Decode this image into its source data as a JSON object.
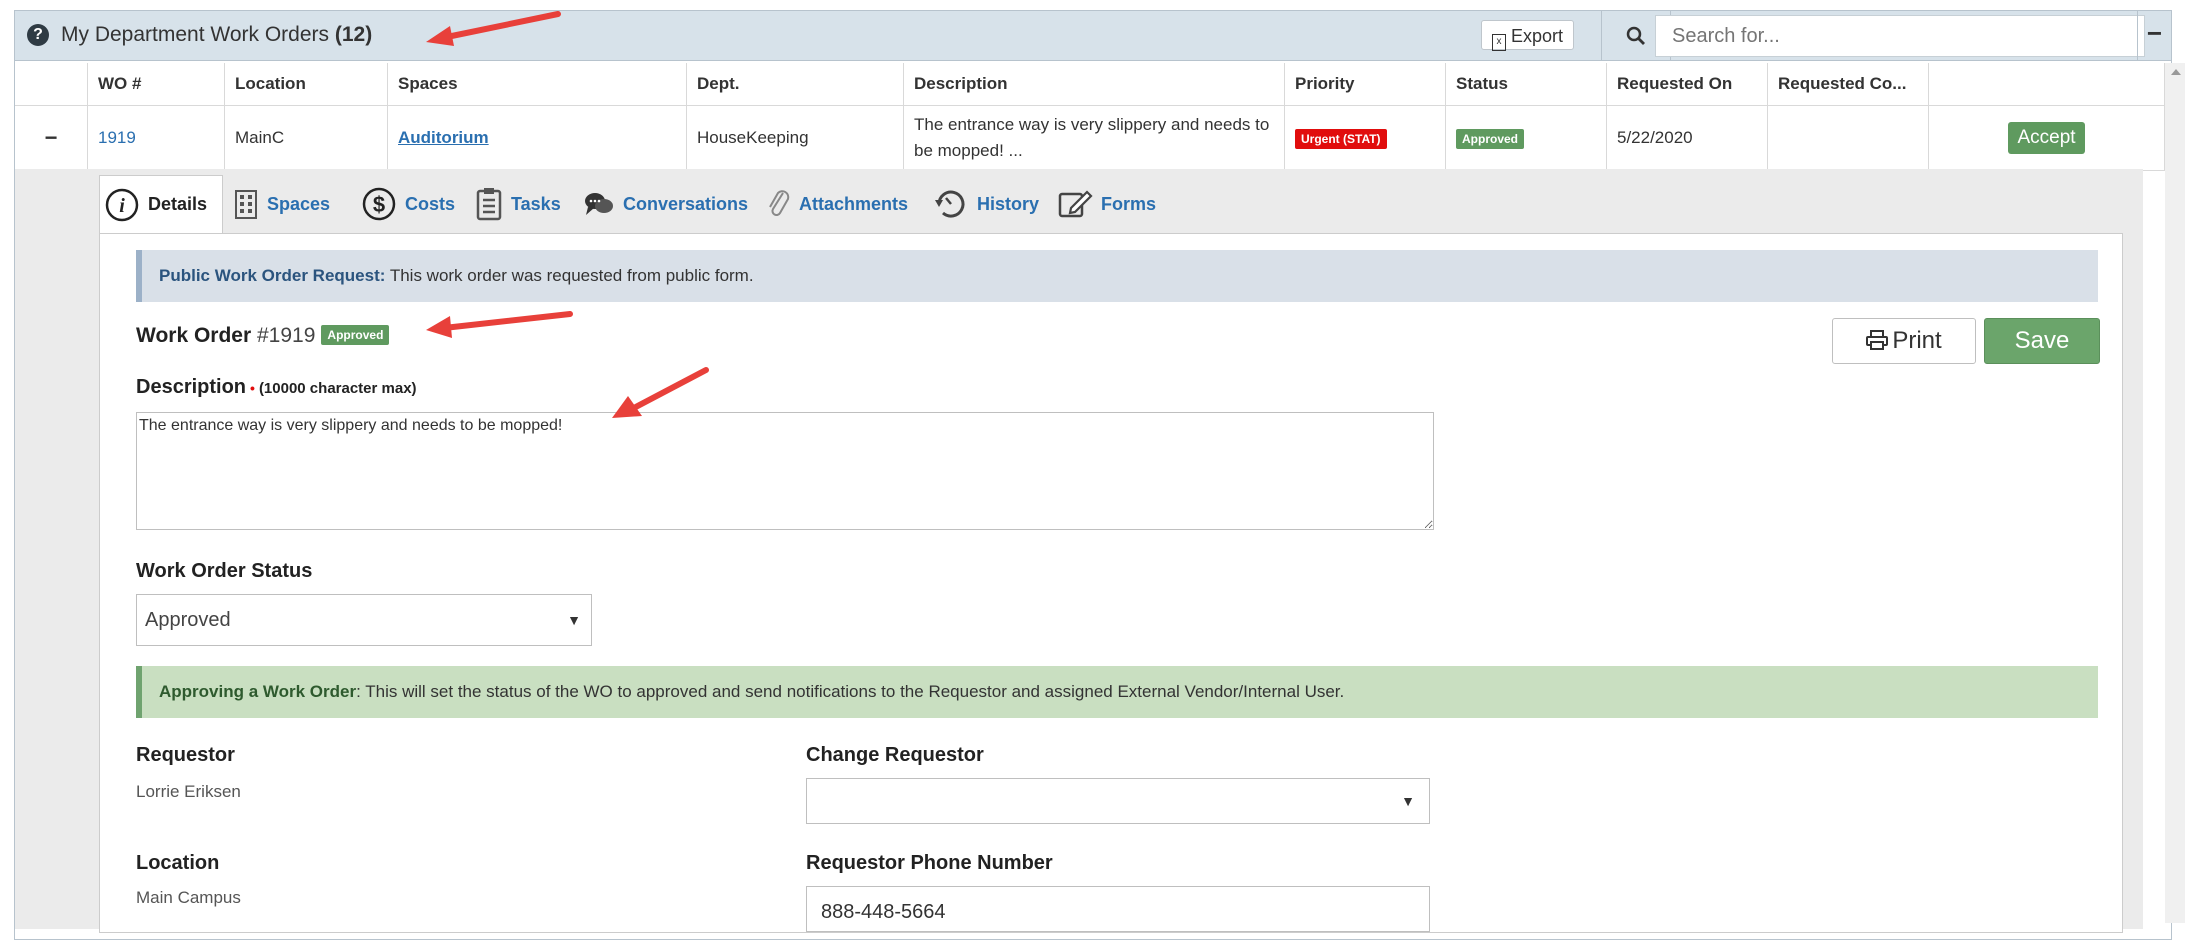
{
  "panel": {
    "title": "My Department Work Orders",
    "count": "(12)",
    "export_label": "Export",
    "search_placeholder": "Search for...",
    "collapse_symbol": "−"
  },
  "table": {
    "headers": [
      "WO #",
      "Location",
      "Spaces",
      "Dept.",
      "Description",
      "Priority",
      "Status",
      "Requested On",
      "Requested Co...",
      ""
    ],
    "row": {
      "toggle": "−",
      "wo": "1919",
      "location": "MainC",
      "space": "Auditorium",
      "dept": "HouseKeeping",
      "description": "The entrance way is very slippery and needs to be mopped! ...",
      "priority": "Urgent (STAT)",
      "status": "Approved",
      "requested_on": "5/22/2020",
      "requested_completion": "",
      "action": "Accept"
    }
  },
  "tabs": [
    "Details",
    "Spaces",
    "Costs",
    "Tasks",
    "Conversations",
    "Attachments",
    "History",
    "Forms"
  ],
  "detail": {
    "public_notice_bold": "Public Work Order Request:",
    "public_notice_text": " This work order was requested from public form.",
    "wo_label": "Work Order",
    "wo_number": "#1919",
    "wo_status_badge": "Approved",
    "print_label": "Print",
    "save_label": "Save",
    "description_label": "Description",
    "required_mark": "•",
    "description_max": "(10000 character max)",
    "description_value": "The entrance way is very slippery and needs to be mopped!",
    "status_label": "Work Order Status",
    "status_value": "Approved",
    "approve_notice_bold": "Approving a Work Order",
    "approve_notice_text": ": This will set the status of the WO to approved and send notifications to the Requestor and assigned External Vendor/Internal User.",
    "requestor_label": "Requestor",
    "requestor_value": "Lorrie Eriksen",
    "change_requestor_label": "Change Requestor",
    "location_label": "Location",
    "location_value": "Main Campus",
    "phone_label": "Requestor Phone Number",
    "phone_value": "888-448-5664"
  },
  "colors": {
    "header_bg": "#d7e2ea",
    "link": "#2a6fb0",
    "urgent": "#e10d0d",
    "approved": "#5f9a5f",
    "annotation_arrow": "#e8403a"
  }
}
